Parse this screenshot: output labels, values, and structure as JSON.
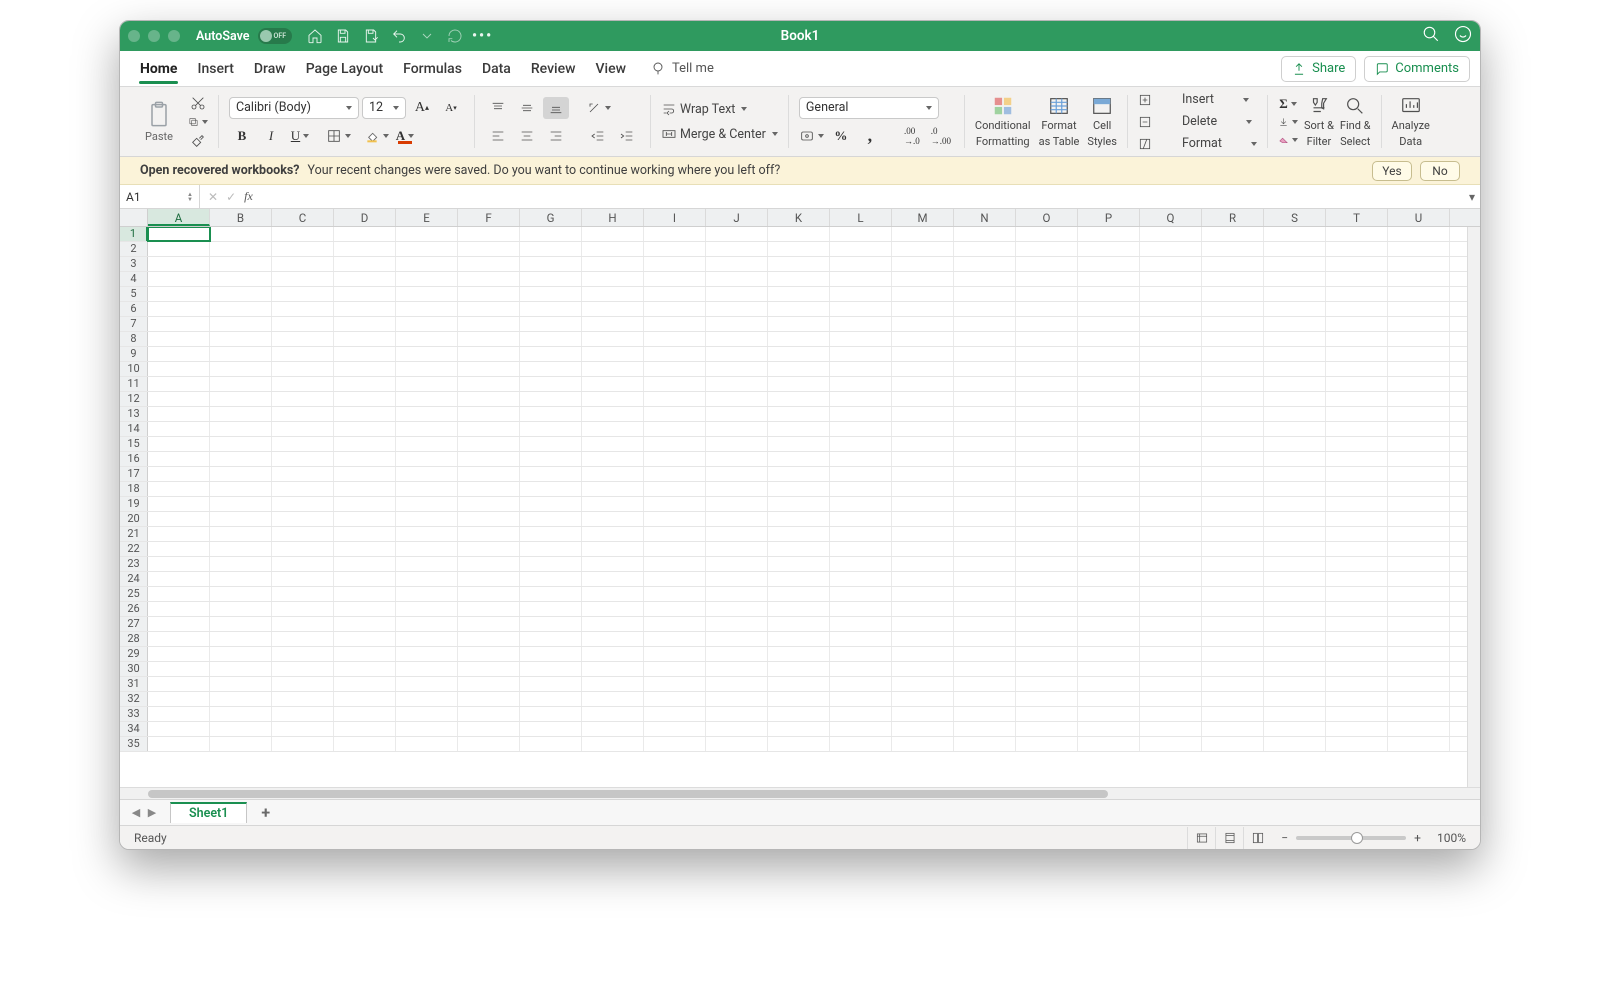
{
  "titlebar": {
    "autosave": "AutoSave",
    "toggle": "OFF",
    "title": "Book1"
  },
  "tabs": [
    "Home",
    "Insert",
    "Draw",
    "Page Layout",
    "Formulas",
    "Data",
    "Review",
    "View"
  ],
  "activeTab": "Home",
  "tellme": "Tell me",
  "share": "Share",
  "comments": "Comments",
  "ribbon": {
    "paste": "Paste",
    "font": "Calibri (Body)",
    "size": "12",
    "wrap": "Wrap Text",
    "merge": "Merge & Center",
    "numfmt": "General",
    "cond": {
      "l1": "Conditional",
      "l2": "Formatting"
    },
    "fat": {
      "l1": "Format",
      "l2": "as Table"
    },
    "cst": {
      "l1": "Cell",
      "l2": "Styles"
    },
    "insert": "Insert",
    "delete": "Delete",
    "format": "Format",
    "sort": {
      "l1": "Sort &",
      "l2": "Filter"
    },
    "find": {
      "l1": "Find &",
      "l2": "Select"
    },
    "analyze": {
      "l1": "Analyze",
      "l2": "Data"
    }
  },
  "msg": {
    "head": "Open recovered workbooks?",
    "body": "Your recent changes were saved. Do you want to continue working where you left off?",
    "yes": "Yes",
    "no": "No"
  },
  "namebox": "A1",
  "columns": [
    "A",
    "B",
    "C",
    "D",
    "E",
    "F",
    "G",
    "H",
    "I",
    "J",
    "K",
    "L",
    "M",
    "N",
    "O",
    "P",
    "Q",
    "R",
    "S",
    "T",
    "U"
  ],
  "rowcount": 35,
  "sheet": "Sheet1",
  "status": "Ready",
  "zoom": "100%"
}
